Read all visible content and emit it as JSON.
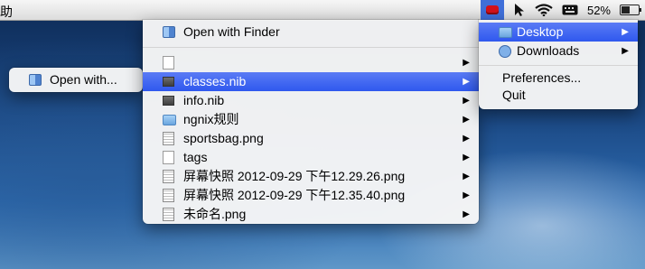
{
  "menubar": {
    "left_fragment": "助",
    "battery_percent": "52%",
    "battery_level": 0.52
  },
  "open_with_menu": {
    "label": "Open with..."
  },
  "files_menu": {
    "open_with_finder": "Open with Finder",
    "items": [
      {
        "label": "",
        "icon": "blank-document-icon",
        "has_submenu": true
      },
      {
        "label": "classes.nib",
        "icon": "nib-icon",
        "has_submenu": true,
        "selected": true
      },
      {
        "label": "info.nib",
        "icon": "nib-icon",
        "has_submenu": true
      },
      {
        "label": "ngnix规则",
        "icon": "folder-icon",
        "has_submenu": true
      },
      {
        "label": "sportsbag.png",
        "icon": "image-file-icon",
        "has_submenu": true
      },
      {
        "label": "tags",
        "icon": "blank-document-icon",
        "has_submenu": true
      },
      {
        "label": "屏幕快照 2012-09-29 下午12.29.26.png",
        "icon": "image-file-icon",
        "has_submenu": true
      },
      {
        "label": "屏幕快照 2012-09-29 下午12.35.40.png",
        "icon": "image-file-icon",
        "has_submenu": true
      },
      {
        "label": "未命名.png",
        "icon": "image-file-icon",
        "has_submenu": true
      }
    ]
  },
  "places_menu": {
    "items": [
      {
        "label": "Desktop",
        "icon": "desktop-folder-icon",
        "selected": true,
        "has_submenu": true
      },
      {
        "label": "Downloads",
        "icon": "downloads-folder-icon",
        "has_submenu": true
      }
    ],
    "preferences": "Preferences...",
    "quit": "Quit"
  },
  "colors": {
    "selection": "#3a62f0",
    "app_icon": "#d3121a"
  }
}
